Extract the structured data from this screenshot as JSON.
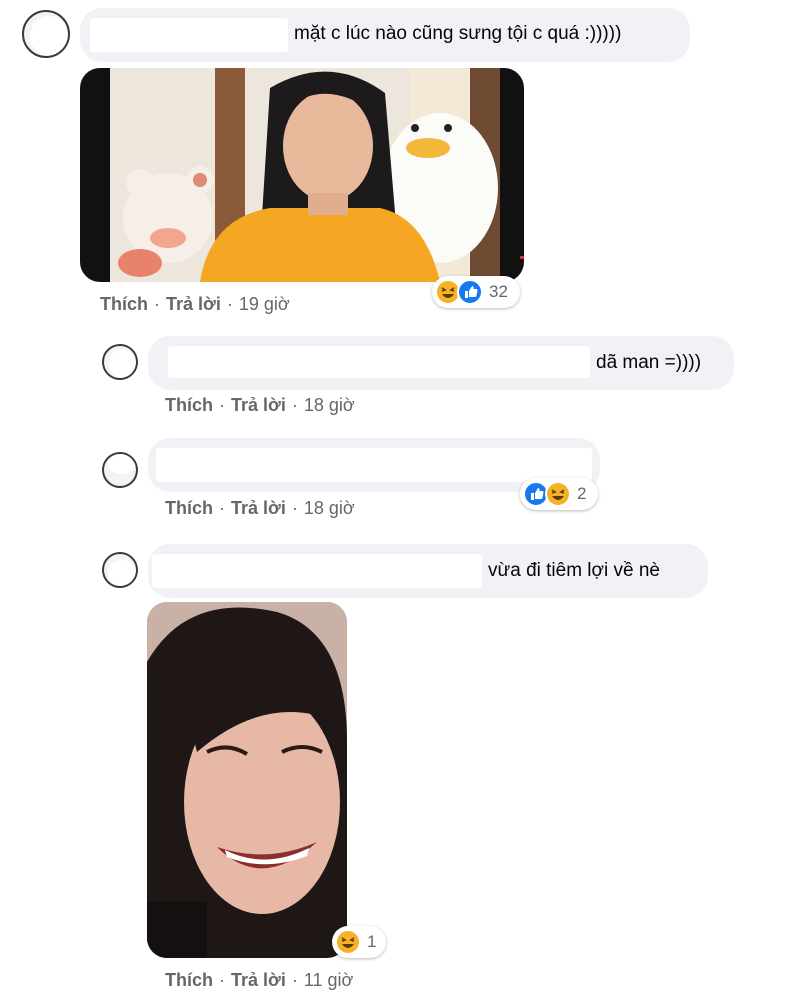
{
  "comments": [
    {
      "text": "mặt c lúc nào cũng sưng tội c quá :)))))",
      "actions": {
        "like": "Thích",
        "reply": "Trả lời",
        "time": "19 giờ"
      },
      "reaction": {
        "icons": [
          "haha-icon",
          "like-icon"
        ],
        "count": "32"
      }
    },
    {
      "text": "dã man =))))",
      "actions": {
        "like": "Thích",
        "reply": "Trả lời",
        "time": "18 giờ"
      }
    },
    {
      "text": "",
      "actions": {
        "like": "Thích",
        "reply": "Trả lời",
        "time": "18 giờ"
      },
      "reaction": {
        "icons": [
          "like-icon",
          "haha-icon"
        ],
        "count": "2"
      }
    },
    {
      "text": "vừa đi tiêm lợi về nè",
      "actions": {
        "like": "Thích",
        "reply": "Trả lời",
        "time": "11 giờ"
      },
      "reaction": {
        "icons": [
          "haha-icon"
        ],
        "count": "1"
      }
    }
  ],
  "separator": "·",
  "colors": {
    "bubble": "#f0f2f5",
    "meta_text": "#65676b",
    "like_blue": "#1877f2",
    "haha_yellow": "#f7b125"
  }
}
